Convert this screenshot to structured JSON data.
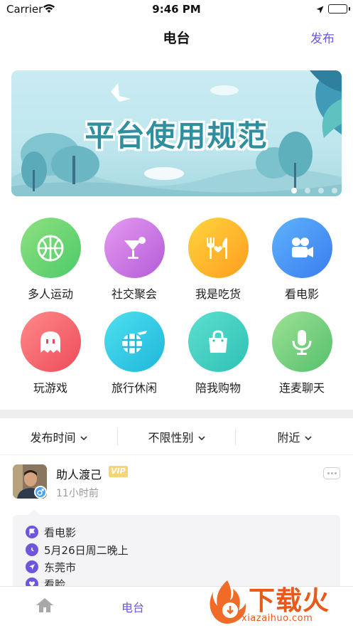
{
  "status_bar": {
    "carrier": "Carrier",
    "time": "9:46 PM"
  },
  "nav": {
    "title": "电台",
    "action_label": "发布",
    "accent": "#6d56e0"
  },
  "banner": {
    "text": "平台使用规范",
    "page_count": 5,
    "active_index": 0
  },
  "categories": [
    {
      "label": "多人运动",
      "icon": "basketball-icon",
      "colors": [
        "#8fe07e",
        "#4ccb6a"
      ]
    },
    {
      "label": "社交聚会",
      "icon": "cocktail-icon",
      "colors": [
        "#e59bf0",
        "#b45bd8"
      ]
    },
    {
      "label": "我是吃货",
      "icon": "food-icon",
      "colors": [
        "#ffd53f",
        "#ff9d1e"
      ]
    },
    {
      "label": "看电影",
      "icon": "movie-camera-icon",
      "colors": [
        "#5db3fb",
        "#3b7cf0"
      ]
    },
    {
      "label": "玩游戏",
      "icon": "ghost-icon",
      "colors": [
        "#ff8a8a",
        "#ec4c5a"
      ]
    },
    {
      "label": "旅行休闲",
      "icon": "travel-globe-icon",
      "colors": [
        "#4ee0ee",
        "#1fb7dc"
      ]
    },
    {
      "label": "陪我购物",
      "icon": "shopping-bag-icon",
      "colors": [
        "#5ddfcf",
        "#2fc1b4"
      ]
    },
    {
      "label": "连麦聊天",
      "icon": "microphone-icon",
      "colors": [
        "#9de294",
        "#55c06c"
      ]
    }
  ],
  "filters": [
    {
      "label": "发布时间"
    },
    {
      "label": "不限性别"
    },
    {
      "label": "附近"
    }
  ],
  "post": {
    "username": "助人渡己",
    "badge": "VIP",
    "time_ago": "11小时前",
    "gender_icon": "male-icon",
    "details": [
      {
        "icon": "flag-icon",
        "text": "看电影"
      },
      {
        "icon": "clock-icon",
        "text": "5月26日周二晚上"
      },
      {
        "icon": "location-arrow-icon",
        "text": "东莞市"
      },
      {
        "icon": "heart-icon",
        "text": "看脸"
      }
    ]
  },
  "tabs": [
    {
      "label": "",
      "icon": "home-icon"
    },
    {
      "label": "电台",
      "icon": ""
    }
  ],
  "watermark": {
    "text": "下载火",
    "url": "xiazaihuo.com"
  }
}
